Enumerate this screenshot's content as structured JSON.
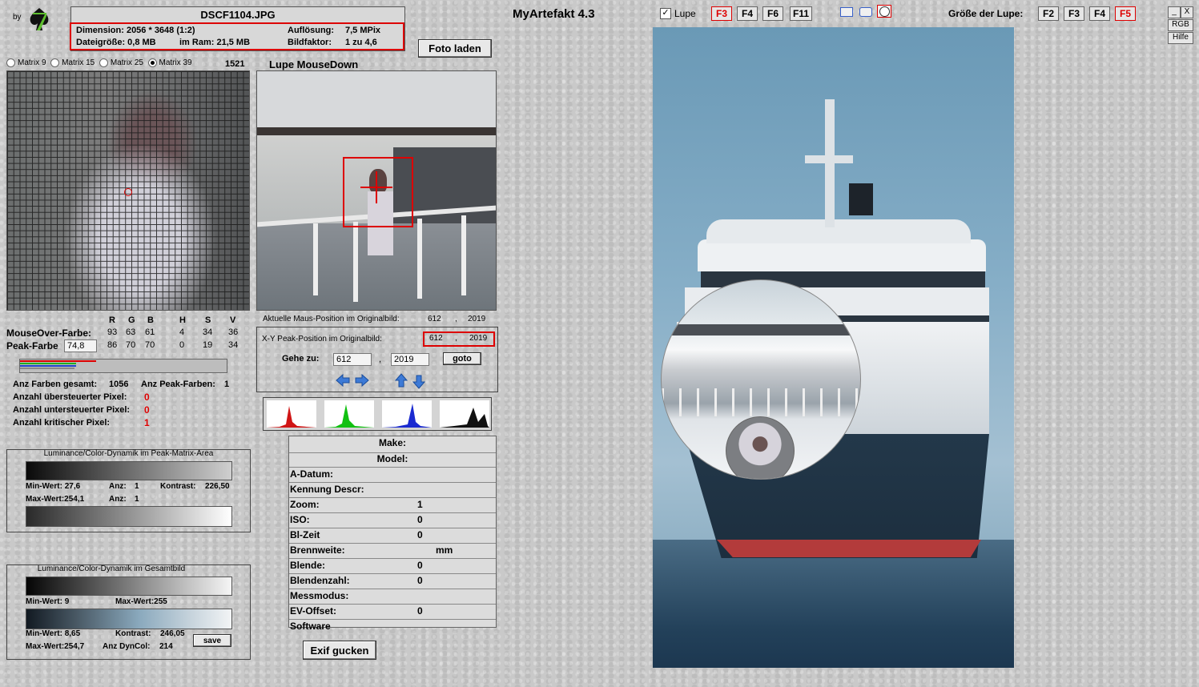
{
  "app": {
    "title": "MyArtefakt 4.3",
    "by_label": "by"
  },
  "file_info": {
    "filename": "DSCF1104.JPG",
    "dimension_label": "Dimension: 2056 * 3648 (1:2)",
    "resolution_label": "Auflösung:",
    "resolution_value": "7,5 MPix",
    "filesize_label": "Dateigröße: 0,8 MB",
    "ram_label": "im Ram: 21,5 MB",
    "scale_label": "Bildfaktor:",
    "scale_value": "1 zu 4,6"
  },
  "load_button": "Foto laden",
  "lupe": {
    "checkbox_label": "Lupe",
    "checked": true,
    "key_buttons": [
      "F3",
      "F4",
      "F6",
      "F11"
    ],
    "size_label": "Größe der Lupe:",
    "size_buttons": [
      "F2",
      "F3",
      "F4",
      "F5"
    ]
  },
  "window_buttons": {
    "min": "_",
    "close": "X",
    "rgb": "RGB",
    "help": "Hilfe"
  },
  "matrix": {
    "options": [
      "Matrix 9",
      "Matrix 15",
      "Matrix 25",
      "Matrix 39"
    ],
    "selected": "Matrix 39",
    "count": "1521"
  },
  "loupe_panel": {
    "title": "Lupe MouseDown"
  },
  "color_table": {
    "headers": [
      "R",
      "G",
      "B",
      "H",
      "S",
      "V"
    ],
    "mouseover_label": "MouseOver-Farbe:",
    "mouseover_values": [
      "93",
      "63",
      "61",
      "4",
      "34",
      "36"
    ],
    "peak_label": "Peak-Farbe",
    "peak_field": "74,8",
    "peak_values": [
      "86",
      "70",
      "70",
      "0",
      "19",
      "34"
    ]
  },
  "stats": {
    "total_colors_label": "Anz Farben gesamt:",
    "total_colors": "1056",
    "peak_colors_label": "Anz Peak-Farben:",
    "peak_colors": "1",
    "overexposed_label": "Anzahl übersteuerter Pixel:",
    "overexposed": "0",
    "underexposed_label": "Anzahl untersteuerter Pixel:",
    "underexposed": "0",
    "critical_label": "Anzahl kritischer Pixel:",
    "critical": "1"
  },
  "dyn_peak": {
    "title": "Luminance/Color-Dynamik im Peak-Matrix-Area",
    "min_label": "Min-Wert: 27,6",
    "anz1_label": "Anz:",
    "anz1": "1",
    "contrast_label": "Kontrast:",
    "contrast": "226,50",
    "max_label": "Max-Wert:254,1",
    "anz2_label": "Anz:",
    "anz2": "1"
  },
  "dyn_total": {
    "title": "Luminance/Color-Dynamik im Gesamtbild",
    "min1": "Min-Wert: 9",
    "max1": "Max-Wert:255",
    "min2": "Min-Wert: 8,65",
    "contrast_label": "Kontrast:",
    "contrast": "246,05",
    "max2": "Max-Wert:254,7",
    "dyncol_label": "Anz DynCol:",
    "dyncol": "214",
    "save_button": "save"
  },
  "position": {
    "current_label": "Aktuelle Maus-Position  im Originalbild:",
    "current_x": "612",
    "current_y": "2019",
    "sep": ",",
    "peak_label": "X-Y Peak-Position  im Originalbild:",
    "peak_x": "612",
    "peak_y": "2019",
    "goto_label": "Gehe zu:",
    "goto_x": "612",
    "goto_y": "2019",
    "goto_button": "goto"
  },
  "exif": {
    "make_label": "Make:",
    "model_label": "Model:",
    "rows": [
      {
        "label": "A-Datum:",
        "value": ""
      },
      {
        "label": "Kennung Descr:",
        "value": ""
      },
      {
        "label": "Zoom:",
        "value": "1"
      },
      {
        "label": "ISO:",
        "value": "0"
      },
      {
        "label": "Bl-Zeit",
        "value": "0"
      },
      {
        "label": "Brennweite:",
        "value": "mm"
      },
      {
        "label": "Blende:",
        "value": "0"
      },
      {
        "label": "Blendenzahl:",
        "value": "0"
      },
      {
        "label": "Messmodus:",
        "value": ""
      },
      {
        "label": "EV-Offset:",
        "value": "0"
      },
      {
        "label": "Software",
        "value": ""
      }
    ],
    "button": "Exif gucken"
  },
  "colors": {
    "accent_red": "#dd0000",
    "panel_bg": "#d4d4d4"
  }
}
